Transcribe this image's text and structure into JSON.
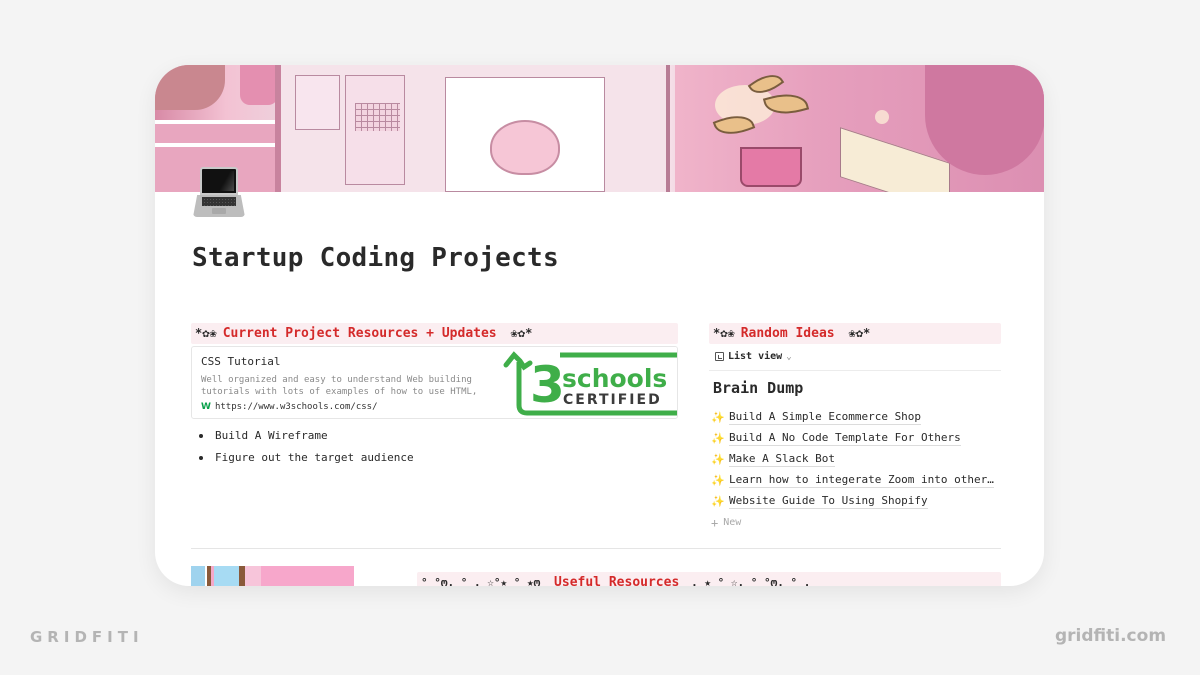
{
  "page": {
    "icon": "laptop-icon",
    "title": "Startup Coding Projects"
  },
  "left_callout": {
    "deco_left": "*✿❀",
    "label": "Current Project Resources + Updates",
    "deco_right": "❀✿*",
    "bookmark": {
      "title": "CSS Tutorial",
      "description_line1": "Well organized and easy to understand Web building",
      "description_line2": "tutorials with lots of examples of how to use HTML,",
      "favicon": "W",
      "url": "https://www.w3schools.com/css/",
      "image_text_top": "schools",
      "image_text_bottom": "CERTIFIED",
      "image_accent": "#3fae49"
    },
    "bullets": [
      "Build A Wireframe",
      "Figure out the target audience"
    ]
  },
  "right_callout": {
    "deco_left": "*✿❀",
    "label": "Random Ideas",
    "deco_right": "❀✿*",
    "view": {
      "label": "List view",
      "chevron": "⌄"
    },
    "list_title": "Brain Dump",
    "items": [
      {
        "icon": "✨",
        "text": "Build A Simple Ecommerce Shop"
      },
      {
        "icon": "✨",
        "text": "Build A No Code Template For Others"
      },
      {
        "icon": "✨",
        "text": "Make A Slack Bot"
      },
      {
        "icon": "✨",
        "text": "Learn how to integerate Zoom into other…"
      },
      {
        "icon": "✨",
        "text": "Website Guide To Using Shopify"
      }
    ],
    "new_label": "New",
    "new_icon": "+"
  },
  "bottom_callout": {
    "deco_left": "° °ო. ° . ☆°★ ° ★ო",
    "label": "Useful Resources",
    "deco_right": ". ★ ° ☆. ° °ო. ° ."
  },
  "watermark": {
    "left": "GRIDFITI",
    "right": "gridfiti.com"
  },
  "colors": {
    "accent_red": "#d42a2a",
    "callout_bg": "#fbeef1",
    "text": "#2a2a2a",
    "muted": "#8a8a8a"
  }
}
